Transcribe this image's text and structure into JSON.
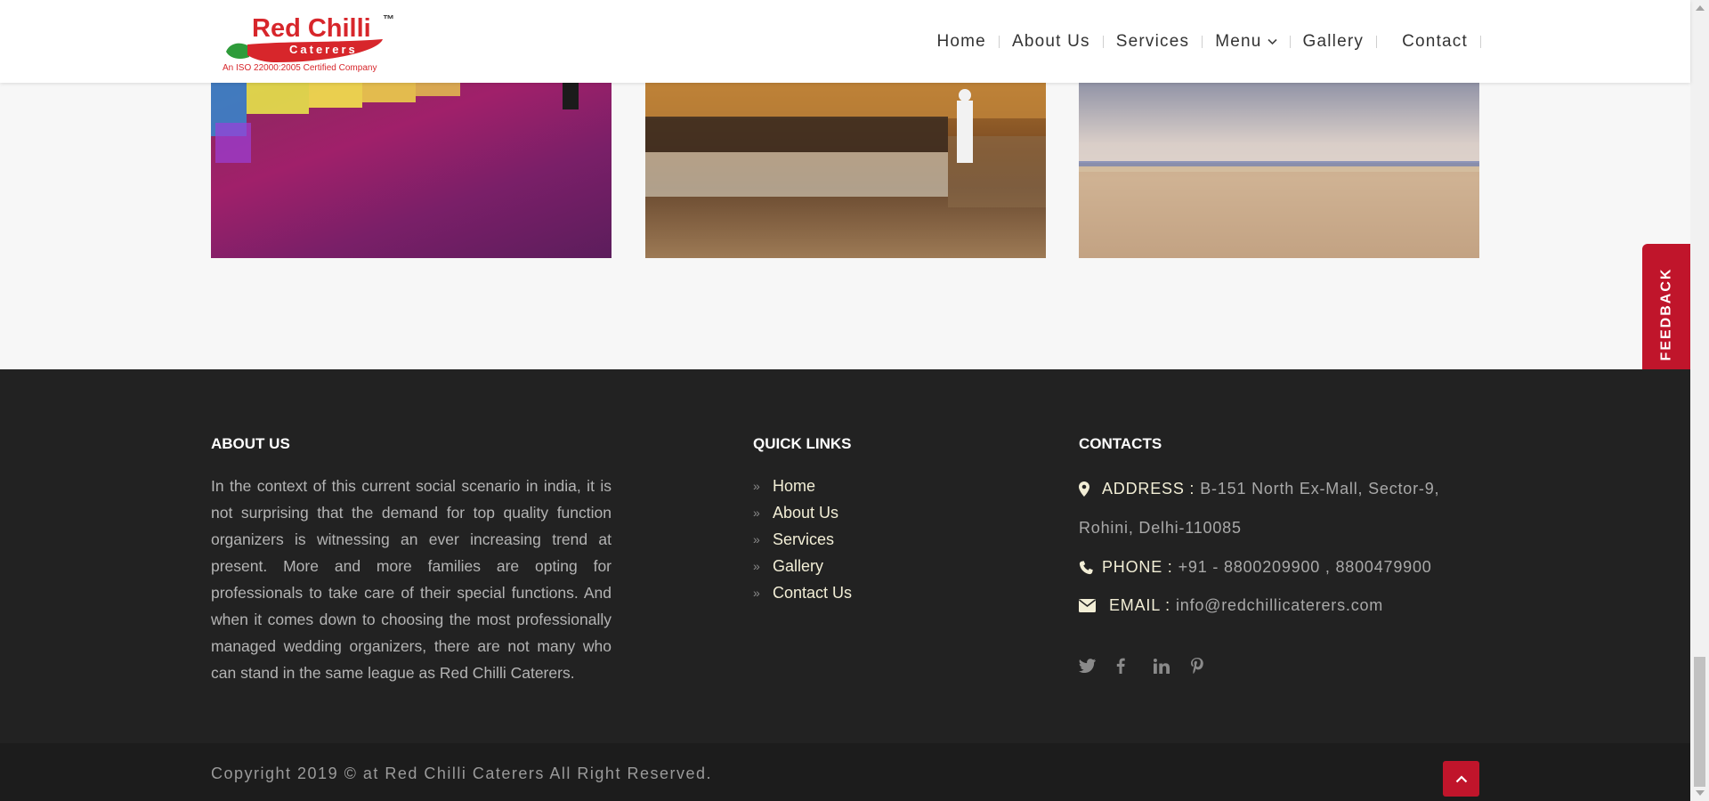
{
  "logo": {
    "title": "Red Chilli",
    "tm": "™",
    "word": "Caterers",
    "subtitle": "An ISO 22000:2005 Certified Company"
  },
  "nav": {
    "items": [
      "Home",
      "About Us",
      "Services",
      "Menu",
      "Gallery",
      "Contact"
    ]
  },
  "feedback": {
    "label": "FEEDBACK"
  },
  "footer": {
    "about": {
      "title": "ABOUT US",
      "text": "In the context of this current social scenario in india, it is not surprising that the demand for top quality function organizers is witnessing an ever increasing trend at present. More and more families are opting for professionals to take care of their special functions. And when it comes down to choosing the most professionally managed wedding organizers, there are not many who can stand in the same league as Red Chilli Caterers."
    },
    "quick_links": {
      "title": "QUICK LINKS",
      "items": [
        "Home",
        "About Us",
        "Services",
        "Gallery",
        "Contact Us"
      ]
    },
    "contacts": {
      "title": "CONTACTS",
      "address_label": "ADDRESS :",
      "address_line1": "B-151 North Ex-Mall, Sector-9,",
      "address_line2": "Rohini, Delhi-110085",
      "phone_label": "PHONE :",
      "phone": "+91 - 8800209900 , 8800479900",
      "email_label": "EMAIL :",
      "email": "info@redchillicaterers.com"
    },
    "social_icons": [
      "twitter-icon",
      "facebook-icon",
      "linkedin-icon",
      "pinterest-icon"
    ]
  },
  "bottom": {
    "copyright": "Copyright 2019 © at Red Chilli Caterers All Right Reserved."
  },
  "colors": {
    "brand_red": "#c0152b",
    "footer_bg": "#222222",
    "link_text": "#f2eed6"
  }
}
